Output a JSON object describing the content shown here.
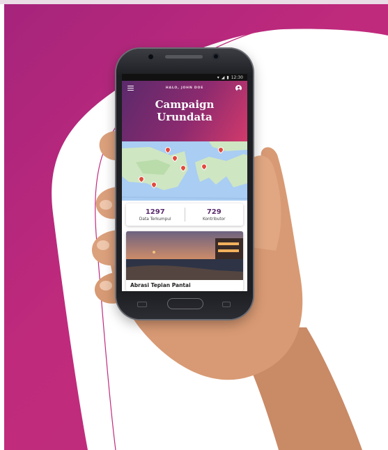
{
  "status_bar": {
    "time": "12:30"
  },
  "app": {
    "greeting": "HALO, JOHN DOE",
    "title_line1": "Campaign",
    "title_line2": "Urundata"
  },
  "stats": [
    {
      "value": "1297",
      "label": "Data Terkumpul"
    },
    {
      "value": "729",
      "label": "Kontributor"
    }
  ],
  "campaign_card": {
    "title": "Abrasi Tepian Pantai"
  },
  "colors": {
    "brand_magenta": "#b02a7c",
    "header_purple": "#5b2a6b",
    "header_pink": "#d23a6b",
    "stat_number": "#5a2a6d",
    "map_pin": "#e2493d"
  },
  "icons": {
    "menu": "hamburger-menu-icon",
    "profile": "user-avatar-icon",
    "map_marker": "map-pin-icon"
  }
}
